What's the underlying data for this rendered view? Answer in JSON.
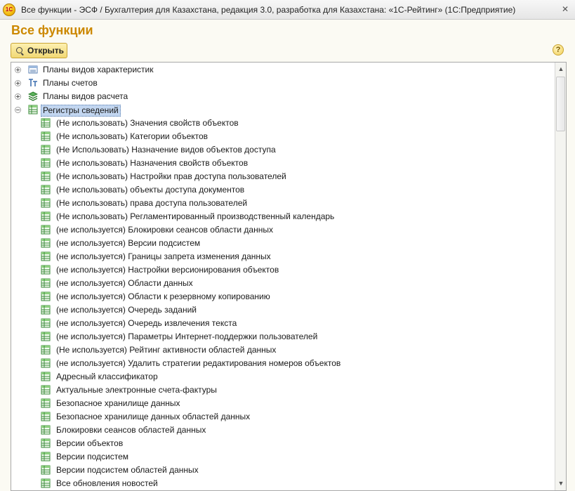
{
  "window": {
    "title": "Все функции - ЭСФ / Бухгалтерия для Казахстана, редакция 3.0, разработка для Казахстана: «1С-Рейтинг»  (1С:Предприятие)",
    "app_icon_text": "1С",
    "close_glyph": "✕"
  },
  "page_title": "Все функции",
  "toolbar": {
    "open_label": "Открыть",
    "help_glyph": "?"
  },
  "tree": {
    "top_items": [
      {
        "label": "Планы видов характеристик",
        "icon": "chart-of-characteristics-icon",
        "expander": "plus"
      },
      {
        "label": "Планы счетов",
        "icon": "chart-of-accounts-icon",
        "expander": "plus"
      },
      {
        "label": "Планы видов расчета",
        "icon": "chart-of-calculation-types-icon",
        "expander": "plus"
      },
      {
        "label": "Регистры сведений",
        "icon": "information-register-icon",
        "expander": "minus",
        "selected": true
      }
    ],
    "children": [
      "(Не использовать) Значения свойств объектов",
      "(Не использовать) Категории объектов",
      "(Не Использовать) Назначение видов объектов доступа",
      "(Не использовать) Назначения свойств объектов",
      "(Не использовать) Настройки прав доступа пользователей",
      "(Не использовать) объекты доступа документов",
      "(Не использовать) права доступа пользователей",
      "(Не использовать) Регламентированный производственный календарь",
      "(не используется) Блокировки сеансов области данных",
      "(не используется) Версии подсистем",
      "(не используется) Границы запрета изменения данных",
      "(не используется) Настройки версионирования объектов",
      "(не используется) Области данных",
      "(не используется) Области к резервному копированию",
      "(не используется) Очередь заданий",
      "(не используется) Очередь извлечения текста",
      "(не используется) Параметры Интернет-поддержки пользователей",
      "(Не используется) Рейтинг активности областей данных",
      "(не используется) Удалить стратегии редактирования номеров объектов",
      "Адресный классификатор",
      "Актуальные электронные счета-фактуры",
      "Безопасное хранилище данных",
      "Безопасное хранилище данных областей данных",
      "Блокировки сеансов областей данных",
      "Версии объектов",
      "Версии подсистем",
      "Версии подсистем областей данных",
      "Все обновления новостей"
    ]
  },
  "scrollbar": {
    "up_glyph": "▲",
    "down_glyph": "▼",
    "thumb_glyph": "≡"
  },
  "colors": {
    "title_accent": "#cc8800",
    "button_fill": "#f1d874",
    "selection": "#c2d6f0",
    "register_icon_green": "#3a8a3a"
  }
}
